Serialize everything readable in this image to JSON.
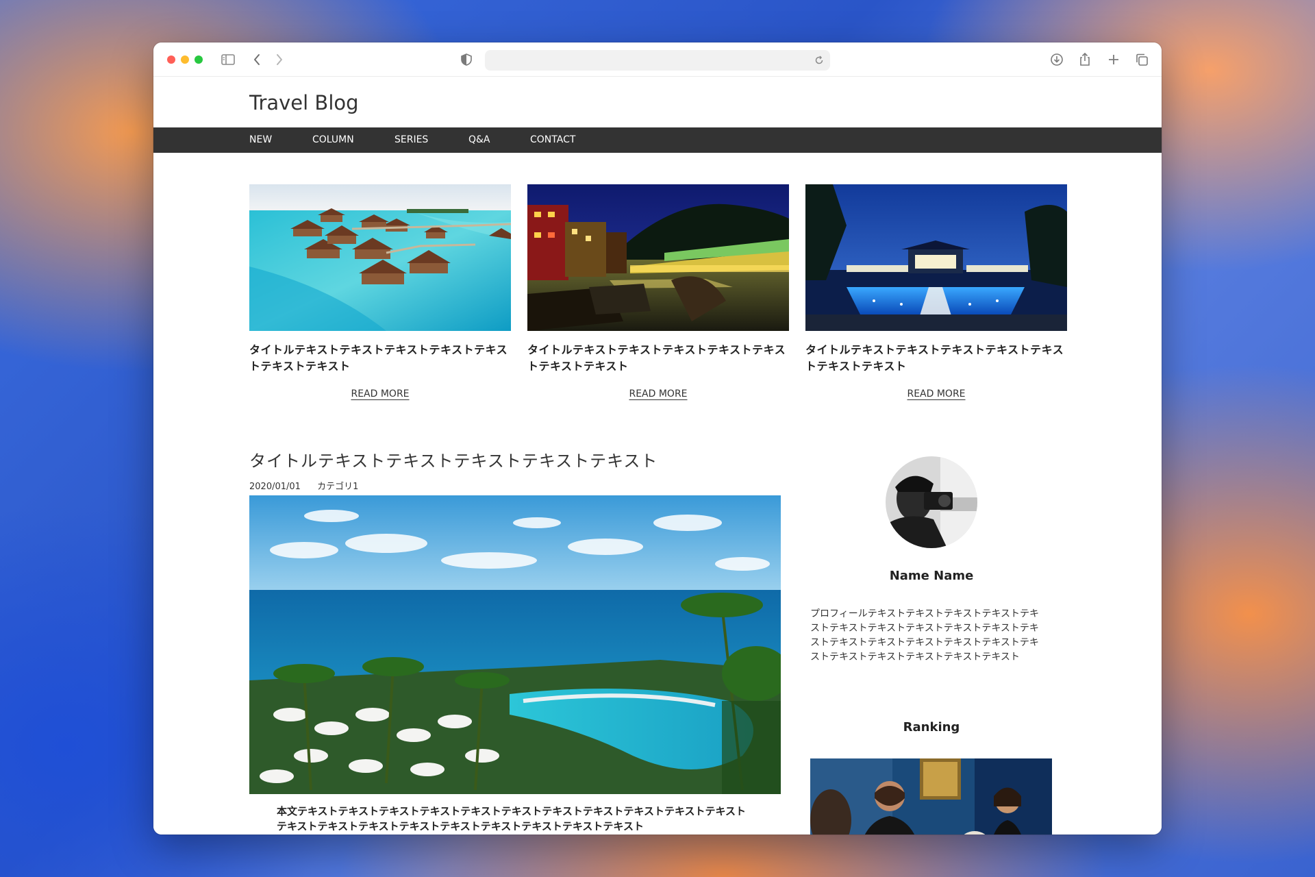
{
  "browser": {
    "url": ""
  },
  "site": {
    "title": "Travel Blog"
  },
  "nav": [
    {
      "label": "NEW"
    },
    {
      "label": "COLUMN"
    },
    {
      "label": "SERIES"
    },
    {
      "label": "Q&A"
    },
    {
      "label": "CONTACT"
    }
  ],
  "cards": [
    {
      "title": "タイトルテキストテキストテキストテキストテキストテキストテキスト",
      "read_more": "READ MORE",
      "image": "overwater-bungalows"
    },
    {
      "title": "タイトルテキストテキストテキストテキストテキストテキストテキスト",
      "read_more": "READ MORE",
      "image": "night-river-town"
    },
    {
      "title": "タイトルテキストテキストテキストテキストテキストテキストテキスト",
      "read_more": "READ MORE",
      "image": "resort-pool-night"
    }
  ],
  "post": {
    "title": "タイトルテキストテキストテキストテキストテキスト",
    "date": "2020/01/01",
    "category": "カテゴリ1",
    "image": "ocean-resort-pool",
    "body": "本文テキストテキストテキストテキストテキストテキストテキストテキストテキストテキストテキストテキストテキストテキストテキストテキストテキストテキストテキストテキスト"
  },
  "profile": {
    "name": "Name Name",
    "text": "プロフィールテキストテキストテキストテキストテキストテキストテキストテキストテキストテキストテキストテキストテキストテキストテキストテキストテキストテキストテキストテキストテキストテキスト",
    "avatar": "photographer-avatar"
  },
  "ranking": {
    "title": "Ranking",
    "image": "restaurant-people"
  },
  "colors": {
    "nav_bg": "#333333",
    "text": "#222222"
  }
}
